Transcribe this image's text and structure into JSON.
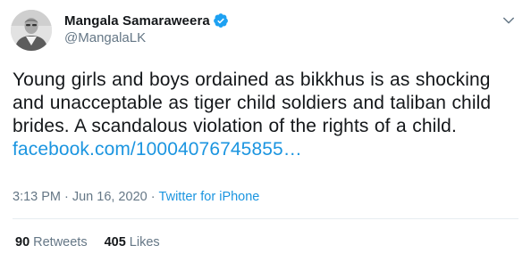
{
  "author": {
    "display_name": "Mangala Samaraweera",
    "handle": "@MangalaLK",
    "verified": true,
    "avatar_icon": "profile-photo"
  },
  "tweet": {
    "text": "Young girls and boys ordained as bikkhus is as shocking and unacceptable as tiger child soldiers and taliban child brides. A scandalous violation of the rights of a child.",
    "link_text": "facebook.com/10004076745855…"
  },
  "meta": {
    "time": "3:13 PM",
    "separator": "·",
    "date": "Jun 16, 2020",
    "source": "Twitter for iPhone"
  },
  "stats": {
    "retweets_count": "90",
    "retweets_label": "Retweets",
    "likes_count": "405",
    "likes_label": "Likes"
  },
  "colors": {
    "link": "#1b95e0",
    "secondary_text": "#657786",
    "verified_badge": "#1da1f2",
    "divider": "#e6ecf0"
  },
  "icons": {
    "verified": "verified-badge-icon",
    "menu": "chevron-down-icon"
  }
}
